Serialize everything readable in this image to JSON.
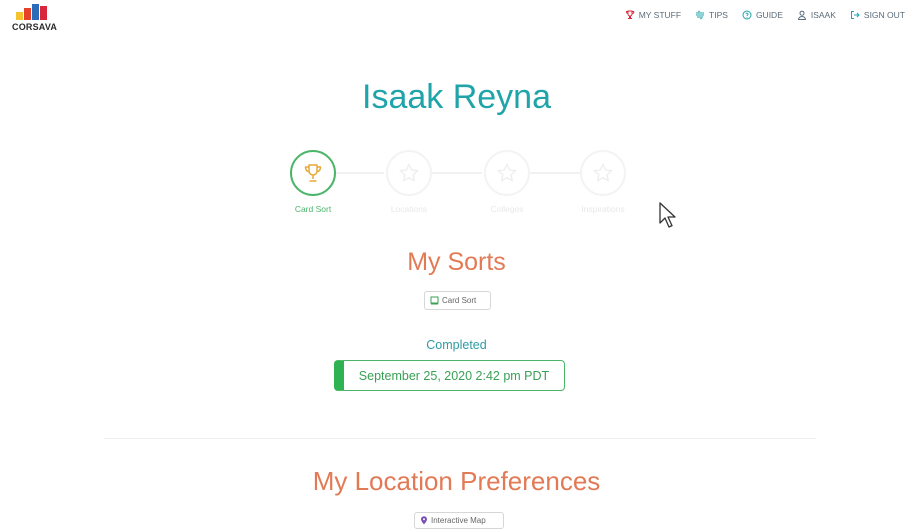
{
  "logo": {
    "text": "CORSAVA",
    "bar_colors": [
      "#f4c430",
      "#e8412a",
      "#2a6cb8",
      "#d8263b"
    ]
  },
  "nav": [
    {
      "label": "MY STUFF",
      "icon": "trophy-icon"
    },
    {
      "label": "TIPS",
      "icon": "tips-icon"
    },
    {
      "label": "GUIDE",
      "icon": "help-circle-icon"
    },
    {
      "label": "ISAAK",
      "icon": "user-icon"
    },
    {
      "label": "SIGN OUT",
      "icon": "sign-out-icon"
    }
  ],
  "profile": {
    "name": "Isaak Reyna"
  },
  "progress": {
    "steps": [
      {
        "label": "Card Sort",
        "icon": "trophy-icon",
        "active": true
      },
      {
        "label": "Locations",
        "icon": "star-icon",
        "active": false
      },
      {
        "label": "Colleges",
        "icon": "star-icon",
        "active": false
      },
      {
        "label": "Inspirations",
        "icon": "star-icon",
        "active": false
      }
    ]
  },
  "my_sorts": {
    "title": "My Sorts",
    "tag_label": "Card Sort",
    "status_label": "Completed",
    "completed_date": "September 25, 2020 2:42 pm PDT"
  },
  "location_prefs": {
    "title": "My Location Preferences",
    "tag_label": "Interactive Map"
  },
  "colors": {
    "accent_teal": "#1fa4a9",
    "section_orange": "#e37a56",
    "success_green": "#2fb352",
    "nav_red": "#d8263b"
  }
}
